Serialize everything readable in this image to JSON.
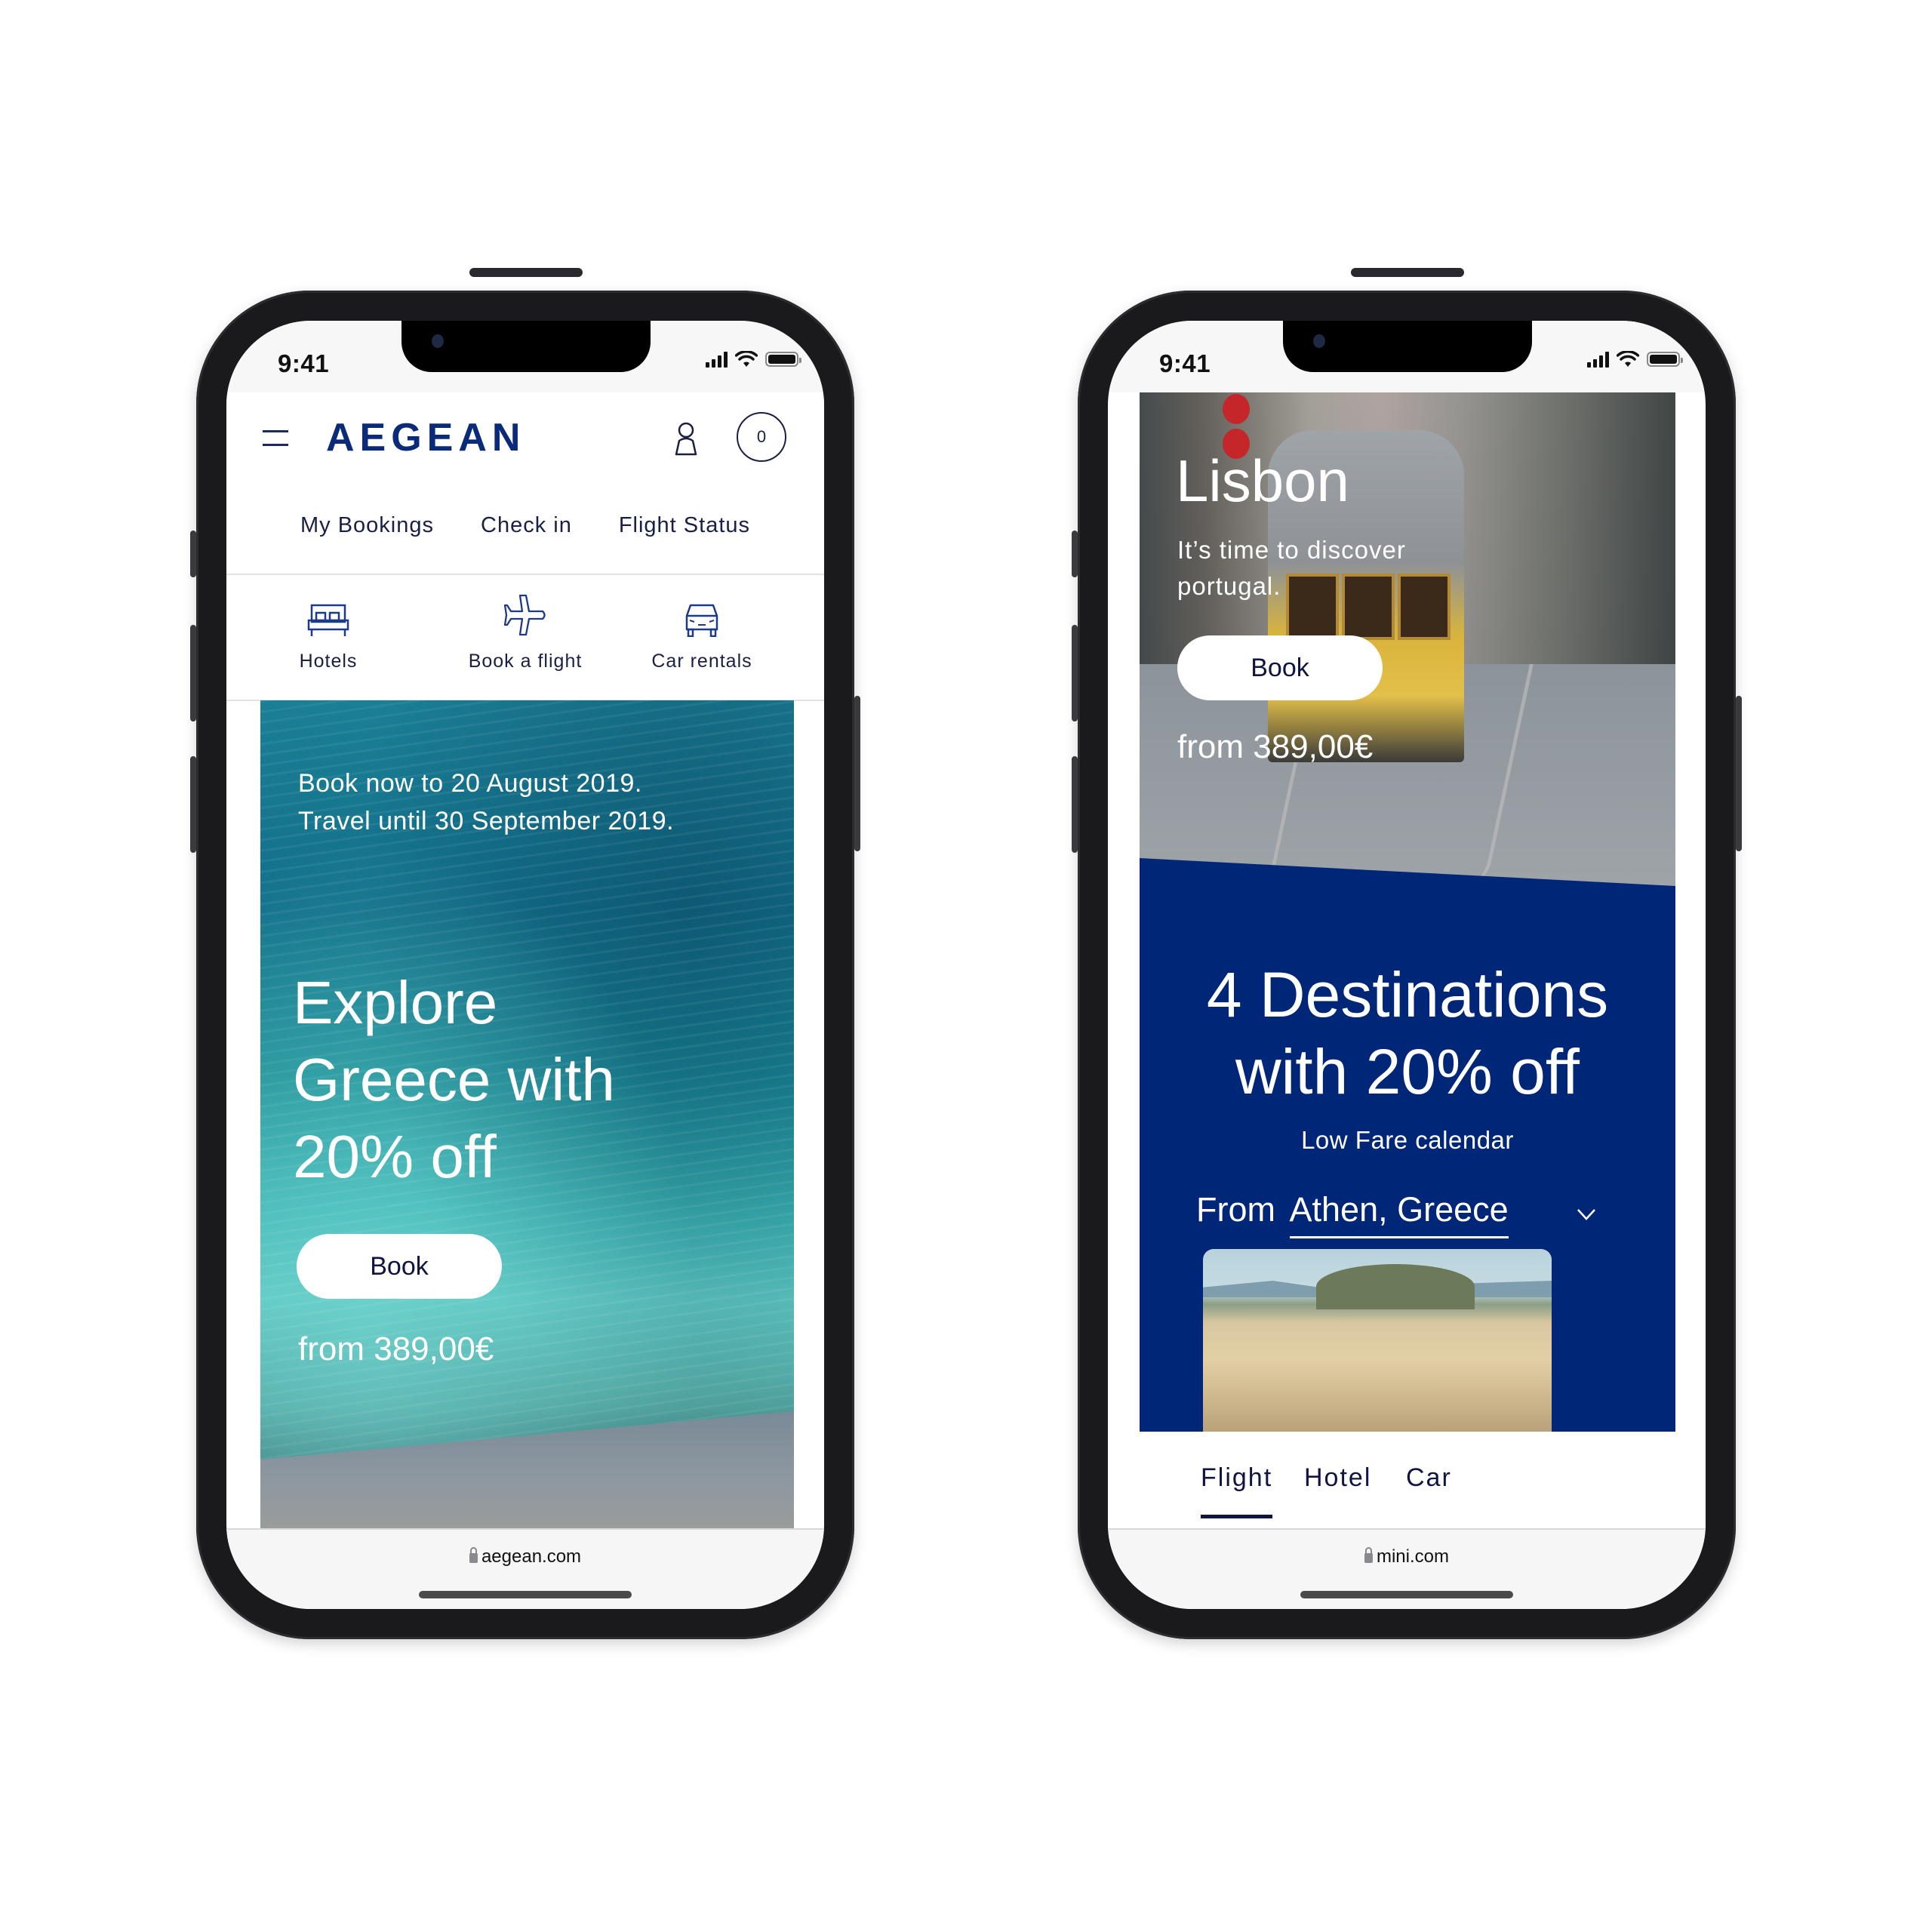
{
  "left_phone": {
    "status_bar": {
      "time": "9:41"
    },
    "header": {
      "logo": "AEGEAN",
      "cart_count": "0",
      "nav_links": [
        "My Bookings",
        "Check in",
        "Flight Status"
      ]
    },
    "quick_actions": [
      {
        "label": "Hotels",
        "icon": "bed-icon"
      },
      {
        "label": "Book a flight",
        "icon": "airplane-icon"
      },
      {
        "label": "Car rentals",
        "icon": "car-icon"
      }
    ],
    "hero": {
      "dates_line1": "Book now to 20 August 2019.",
      "dates_line2": "Travel until 30 September 2019.",
      "title_line1": "Explore",
      "title_line2": "Greece with",
      "title_line3": "20% off",
      "button_label": "Book",
      "price": "from 389,00€"
    },
    "url_bar": {
      "domain": "aegean.com"
    }
  },
  "right_phone": {
    "status_bar": {
      "time": "9:41"
    },
    "hero": {
      "city": "Lisbon",
      "subtitle": "It’s time to discover portugal.",
      "button_label": "Book",
      "price": "from 389,00€"
    },
    "promo": {
      "title_line1": "4 Destinations",
      "title_line2": "with 20% off",
      "calendar_label": "Low Fare calendar",
      "from_prefix": "From",
      "from_value": "Athen, Greece"
    },
    "tabs": [
      {
        "label": "Flight",
        "active": true
      },
      {
        "label": "Hotel",
        "active": false
      },
      {
        "label": "Car",
        "active": false
      }
    ],
    "url_bar": {
      "domain": "mini.com"
    }
  },
  "colors": {
    "brand_navy": "#0a2a7a",
    "promo_blue": "#002677",
    "text_dark": "#0f1540"
  }
}
